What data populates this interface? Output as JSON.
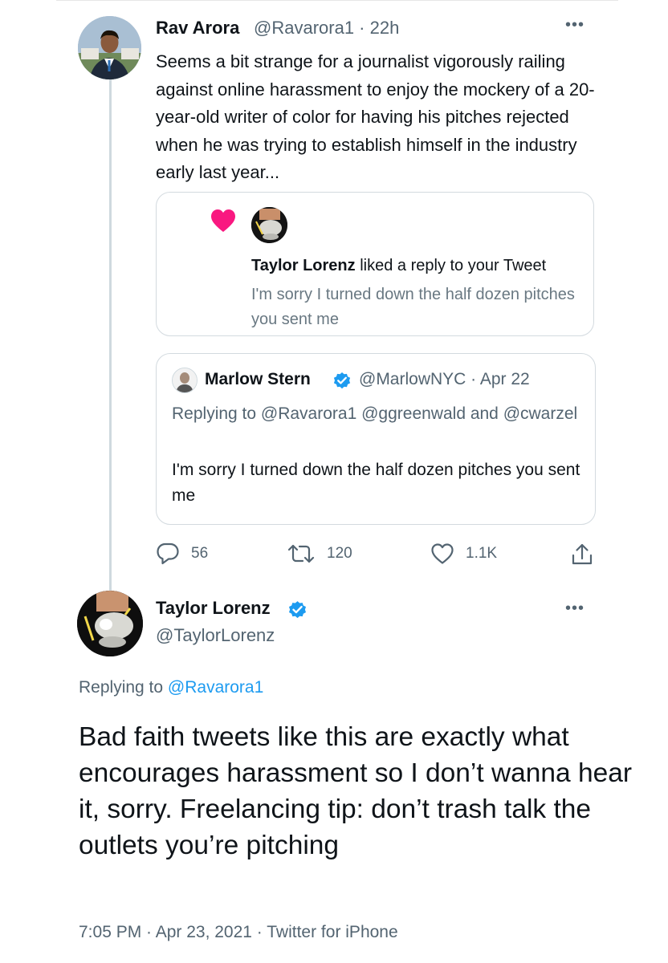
{
  "tweet1": {
    "name": "Rav Arora",
    "handle_time": "@Ravarora1 · 22h",
    "body": "Seems a bit strange for a journalist vigorously railing against online harassment to enjoy the mockery of a 20-year-old writer of color for having his pitches rejected when he was trying to establish himself in the industry early last year...",
    "notification": {
      "actor": "Taylor Lorenz",
      "action": "liked a reply to your Tweet",
      "text": "I'm sorry I turned down the half dozen pitches you sent me"
    },
    "quote": {
      "name": "Marlow Stern",
      "handle_date": "@MarlowNYC · Apr 22",
      "replying": "Replying to @Ravarora1 @ggreenwald and @cwarzel",
      "text": "I'm sorry I turned down the half dozen pitches you sent me"
    },
    "actions": {
      "replies": "56",
      "retweets": "120",
      "likes": "1.1K"
    }
  },
  "tweet2": {
    "name": "Taylor Lorenz",
    "handle": "@TaylorLorenz",
    "replying_prefix": "Replying to ",
    "replying_mention": "@Ravarora1",
    "body": "Bad faith tweets like this are exactly what encourages harassment so I don’t wanna hear it, sorry. Freelancing tip: don’t trash talk the outlets you’re pitching",
    "meta": "7:05 PM · Apr 23, 2021 · Twitter for iPhone"
  },
  "icons": {
    "more": "more-icon",
    "verified": "verified-badge-icon",
    "heart": "heart-icon",
    "reply": "reply-icon",
    "retweet": "retweet-icon",
    "like": "like-icon",
    "share": "share-icon"
  },
  "colors": {
    "text": "#0f1419",
    "secondary": "#536471",
    "link": "#1d9bf0",
    "verified": "#1d9bf0",
    "heart": "#f91880",
    "border": "#d3dadf"
  }
}
